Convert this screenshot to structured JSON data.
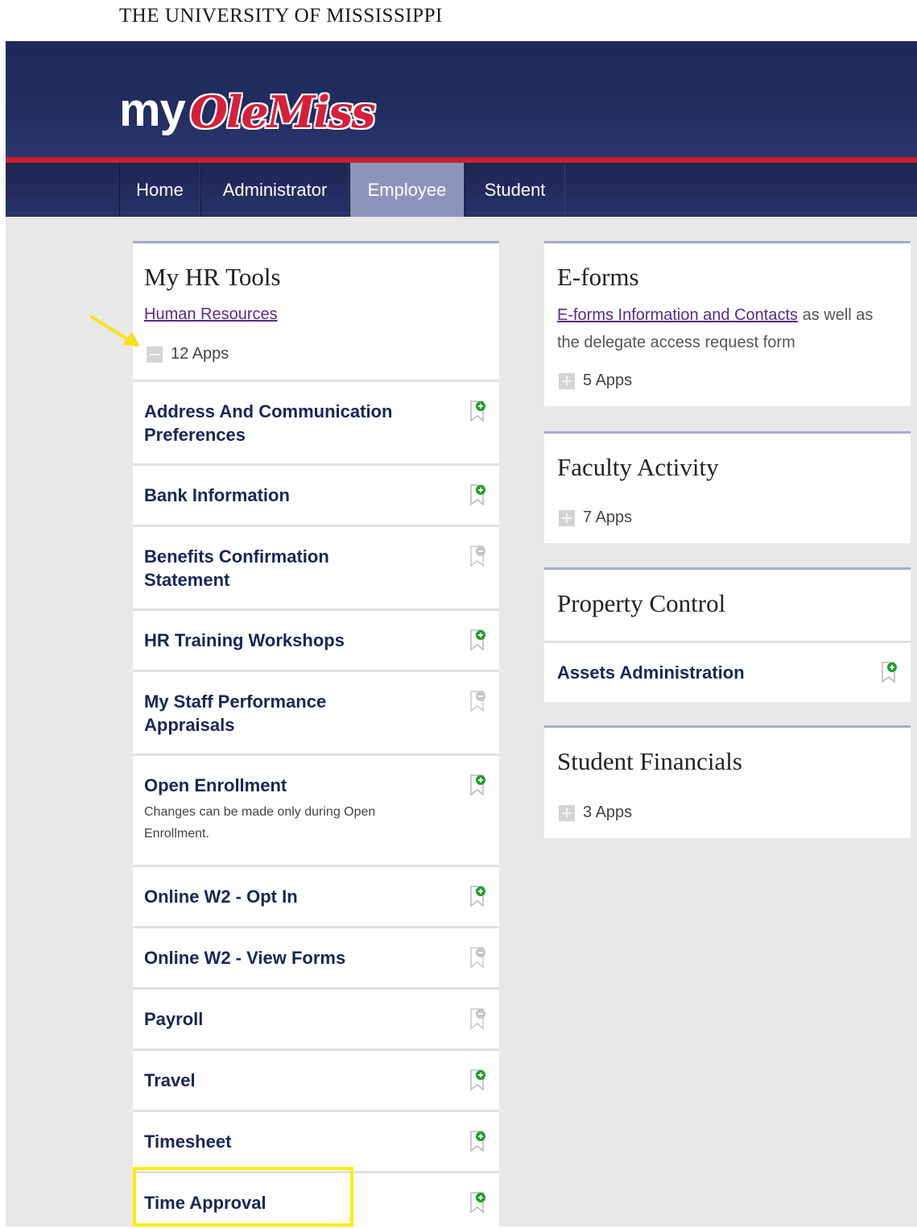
{
  "university_title": "THE UNIVERSITY OF MISSISSIPPI",
  "logo": {
    "prefix": "my",
    "brand": "OleMiss"
  },
  "nav": {
    "items": [
      {
        "label": "Home",
        "active": false
      },
      {
        "label": "Administrator",
        "active": false
      },
      {
        "label": "Employee",
        "active": true
      },
      {
        "label": "Student",
        "active": false
      }
    ]
  },
  "hr_tools": {
    "title": "My HR Tools",
    "link": "Human Resources",
    "apps_count": "12 Apps",
    "apps": [
      {
        "title": "Address And Communication Preferences",
        "favorite": true
      },
      {
        "title": "Bank Information",
        "favorite": true
      },
      {
        "title": "Benefits Confirmation Statement",
        "favorite": false
      },
      {
        "title": "HR Training Workshops",
        "favorite": true
      },
      {
        "title": "My Staff Performance Appraisals",
        "favorite": false
      },
      {
        "title": "Open Enrollment",
        "subtitle": "Changes can be made only during Open Enrollment.",
        "favorite": true
      },
      {
        "title": "Online W2 - Opt In",
        "favorite": true
      },
      {
        "title": "Online W2 - View Forms",
        "favorite": false
      },
      {
        "title": "Payroll",
        "favorite": false
      },
      {
        "title": "Travel",
        "favorite": true
      },
      {
        "title": "Timesheet",
        "favorite": true
      },
      {
        "title": "Time Approval",
        "favorite": true
      }
    ]
  },
  "eforms": {
    "title": "E-forms",
    "link": "E-forms Information and Contacts",
    "desc_rest": " as well as the delegate access request form",
    "apps_count": "5 Apps"
  },
  "faculty_activity": {
    "title": "Faculty Activity",
    "apps_count": "7 Apps"
  },
  "property_control": {
    "title": "Property Control",
    "app": {
      "title": "Assets Administration",
      "favorite": true
    }
  },
  "student_financials": {
    "title": "Student Financials",
    "apps_count": "3 Apps"
  },
  "colors": {
    "accent_red": "#c8202f",
    "navy": "#1d2a5a",
    "active_tab": "#8c95b9",
    "highlight": "#ffee00",
    "add_green": "#1e9c2a"
  }
}
